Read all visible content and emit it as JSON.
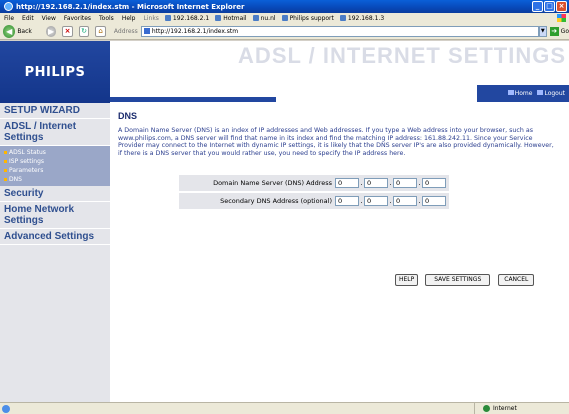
{
  "window": {
    "title": "http://192.168.2.1/index.stm - Microsoft Internet Explorer",
    "buttons": [
      "_",
      "□",
      "×"
    ]
  },
  "menu": {
    "items": [
      "File",
      "Edit",
      "View",
      "Favorites",
      "Tools",
      "Help"
    ],
    "links_label": "Links",
    "links": [
      "192.168.2.1",
      "Hotmail",
      "nu.nl",
      "Philips support",
      "192.168.1.3"
    ]
  },
  "toolbar": {
    "back_label": "Back",
    "address_label": "Address",
    "address_value": "http://192.168.2.1/index.stm",
    "go_label": "Go"
  },
  "header": {
    "logo": "PHILIPS",
    "title": "ADSL / INTERNET SETTINGS",
    "home_label": "Home",
    "logout_label": "Logout"
  },
  "sidebar": {
    "setup_wizard": "SETUP WIZARD",
    "adsl_internet": "ADSL / Internet Settings",
    "sub_items": [
      "ADSL Status",
      "ISP settings",
      "Parameters",
      "DNS"
    ],
    "security": "Security",
    "home_network": "Home Network Settings",
    "advanced": "Advanced Settings"
  },
  "main": {
    "section_title": "DNS",
    "description": "A Domain Name Server (DNS) is an index of IP addresses and Web addresses. If you type a Web address into your browser, such as www.philips.com, a DNS server will find that name in its index and find the matching IP address: 161.88.242.11. Since your Service Provider may connect to the Internet with dynamic IP settings, it is likely that the DNS server IP's are also provided dynamically. However, if there is a DNS server that you would rather use, you need to specify the IP address here.",
    "fields": [
      {
        "label": "Domain Name Server (DNS) Address",
        "octets": [
          "0",
          "0",
          "0",
          "0"
        ]
      },
      {
        "label": "Secondary DNS Address (optional)",
        "octets": [
          "0",
          "0",
          "0",
          "0"
        ]
      }
    ],
    "buttons": {
      "help": "HELP",
      "save": "SAVE SETTINGS",
      "cancel": "CANCEL"
    }
  },
  "statusbar": {
    "zone": "Internet"
  }
}
